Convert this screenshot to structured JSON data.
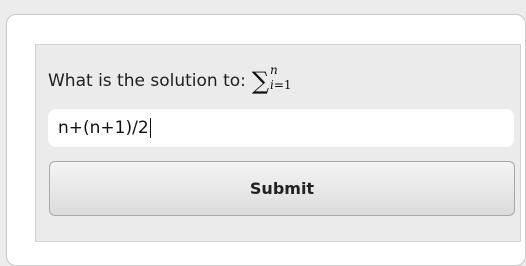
{
  "question": {
    "prefix": "What is the solution to:",
    "math": {
      "operator": "∑",
      "upper_limit": "n",
      "lower_index": "i",
      "lower_equals": "=1"
    }
  },
  "answer": {
    "value": "n+(n+1)/2",
    "focused": true
  },
  "submit_label": "Submit"
}
